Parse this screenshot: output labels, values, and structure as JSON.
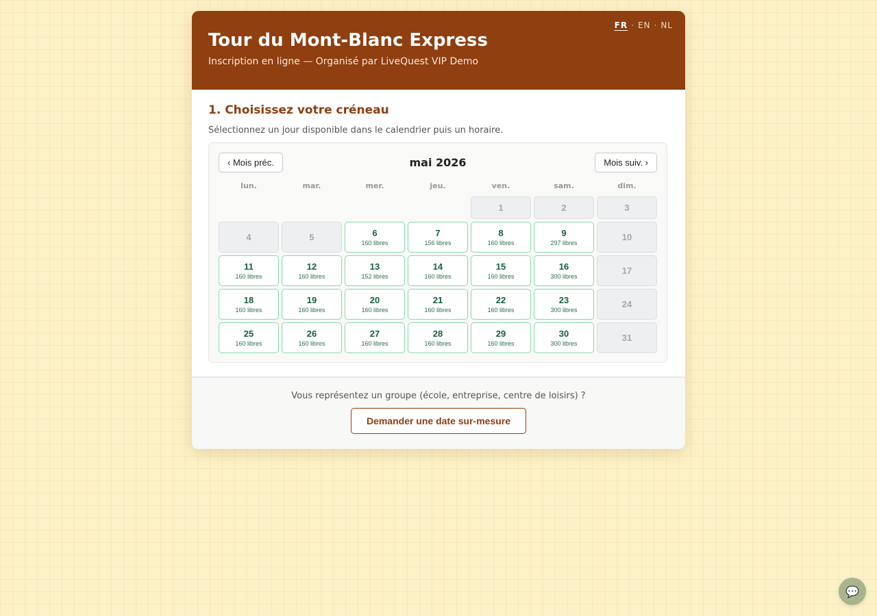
{
  "header": {
    "title": "Tour du Mont-Blanc Express",
    "subtitle": "Inscription en ligne — Organisé par LiveQuest VIP Demo",
    "languages": [
      {
        "code": "FR",
        "active": true
      },
      {
        "code": "EN",
        "active": false
      },
      {
        "code": "NL",
        "active": false
      }
    ],
    "separator": "·"
  },
  "step": {
    "title": "1. Choisissez votre créneau",
    "description": "Sélectionnez un jour disponible dans le calendrier puis un horaire."
  },
  "calendar": {
    "prev_label": "‹ Mois préc.",
    "next_label": "Mois suiv. ›",
    "month_label": "mai 2026",
    "weekdays": [
      "lun.",
      "mar.",
      "mer.",
      "jeu.",
      "ven.",
      "sam.",
      "dim."
    ],
    "leading_blanks": 4,
    "days": [
      {
        "day": "1",
        "available": false
      },
      {
        "day": "2",
        "available": false
      },
      {
        "day": "3",
        "available": false
      },
      {
        "day": "4",
        "available": false
      },
      {
        "day": "5",
        "available": false
      },
      {
        "day": "6",
        "available": true,
        "free": "160 libres"
      },
      {
        "day": "7",
        "available": true,
        "free": "156 libres"
      },
      {
        "day": "8",
        "available": true,
        "free": "160 libres"
      },
      {
        "day": "9",
        "available": true,
        "free": "297 libres"
      },
      {
        "day": "10",
        "available": false
      },
      {
        "day": "11",
        "available": true,
        "free": "160 libres"
      },
      {
        "day": "12",
        "available": true,
        "free": "160 libres"
      },
      {
        "day": "13",
        "available": true,
        "free": "152 libres"
      },
      {
        "day": "14",
        "available": true,
        "free": "160 libres"
      },
      {
        "day": "15",
        "available": true,
        "free": "160 libres"
      },
      {
        "day": "16",
        "available": true,
        "free": "300 libres"
      },
      {
        "day": "17",
        "available": false
      },
      {
        "day": "18",
        "available": true,
        "free": "160 libres"
      },
      {
        "day": "19",
        "available": true,
        "free": "160 libres"
      },
      {
        "day": "20",
        "available": true,
        "free": "160 libres"
      },
      {
        "day": "21",
        "available": true,
        "free": "160 libres"
      },
      {
        "day": "22",
        "available": true,
        "free": "160 libres"
      },
      {
        "day": "23",
        "available": true,
        "free": "300 libres"
      },
      {
        "day": "24",
        "available": false
      },
      {
        "day": "25",
        "available": true,
        "free": "160 libres"
      },
      {
        "day": "26",
        "available": true,
        "free": "160 libres"
      },
      {
        "day": "27",
        "available": true,
        "free": "160 libres"
      },
      {
        "day": "28",
        "available": true,
        "free": "160 libres"
      },
      {
        "day": "29",
        "available": true,
        "free": "160 libres"
      },
      {
        "day": "30",
        "available": true,
        "free": "300 libres"
      },
      {
        "day": "31",
        "available": false
      }
    ]
  },
  "footer": {
    "question": "Vous représentez un groupe (école, entreprise, centre de loisirs) ?",
    "button_label": "Demander une date sur-mesure"
  },
  "chat": {
    "icon": "chat-bubble-icon",
    "glyph": "💬"
  },
  "colors": {
    "brand": "#8f3f10",
    "available_border": "#86dca7",
    "available_text": "#165f3d",
    "unavailable_bg": "#eeeff1"
  }
}
